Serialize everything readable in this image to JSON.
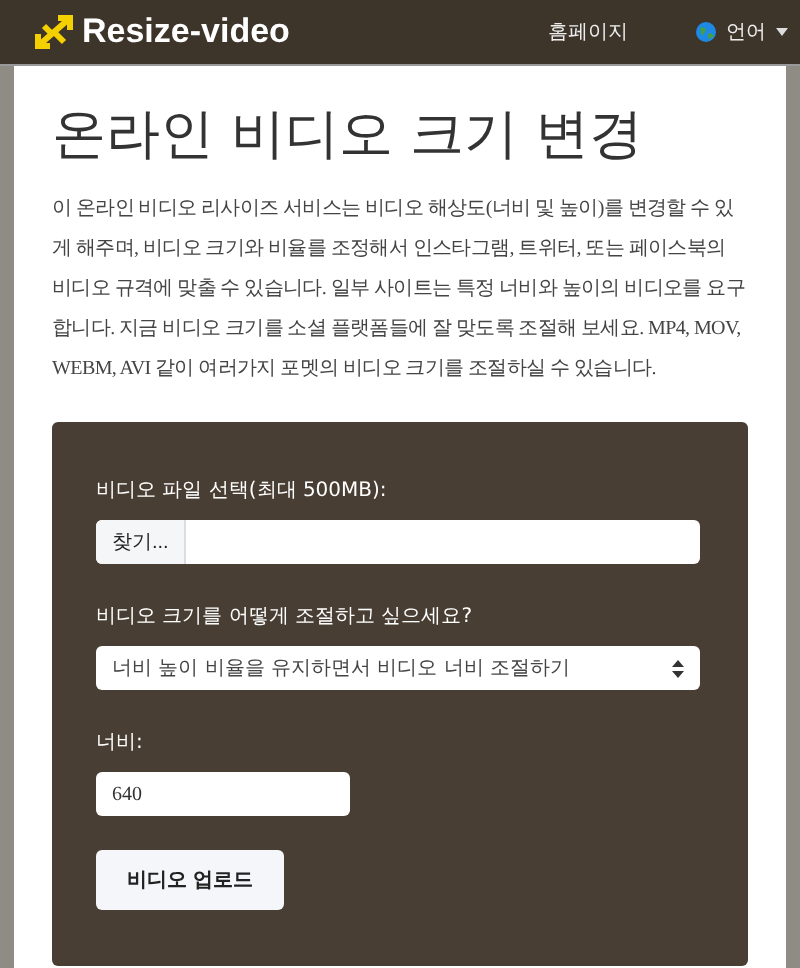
{
  "header": {
    "logo": "Resize-video",
    "nav": [
      {
        "label": "홈페이지",
        "kind": "link"
      },
      {
        "label": "언어",
        "kind": "language"
      }
    ]
  },
  "title": "온라인 비디오 크기 변경",
  "description": "이 온라인 비디오 리사이즈 서비스는 비디오 해상도(너비 및 높이)를 변경할 수 있게 해주며, 비디오 크기와 비율를 조정해서 인스타그램, 트위터, 또는 페이스북의 비디오 규격에 맞출 수 있습니다. 일부 사이트는 특정 너비와 높이의 비디오를 요구합니다. 지금 비디오 크기를 소셜 플랫폼들에 잘 맞도록 조절해 보세요. MP4, MOV, WEBM, AVI 같이 여러가지 포멧의 비디오 크기를 조절하실 수 있습니다.",
  "form": {
    "file_label": "비디오 파일 선택(최대 500MB):",
    "browse_button": "찾기...",
    "mode_label": "비디오 크기를 어떻게 조절하고 싶으세요?",
    "mode_value": "너비 높이 비율을 유지하면서 비디오 너비 조절하기",
    "width_label": "너비:",
    "width_value": "640",
    "upload_button": "비디오 업로드"
  }
}
